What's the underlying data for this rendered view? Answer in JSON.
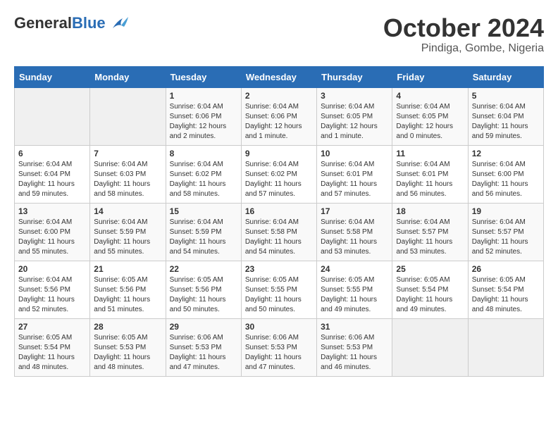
{
  "header": {
    "logo_general": "General",
    "logo_blue": "Blue",
    "month_title": "October 2024",
    "location": "Pindiga, Gombe, Nigeria"
  },
  "days_of_week": [
    "Sunday",
    "Monday",
    "Tuesday",
    "Wednesday",
    "Thursday",
    "Friday",
    "Saturday"
  ],
  "weeks": [
    [
      {
        "day": "",
        "empty": true
      },
      {
        "day": "",
        "empty": true
      },
      {
        "day": "1",
        "sunrise": "Sunrise: 6:04 AM",
        "sunset": "Sunset: 6:06 PM",
        "daylight": "Daylight: 12 hours and 2 minutes."
      },
      {
        "day": "2",
        "sunrise": "Sunrise: 6:04 AM",
        "sunset": "Sunset: 6:06 PM",
        "daylight": "Daylight: 12 hours and 1 minute."
      },
      {
        "day": "3",
        "sunrise": "Sunrise: 6:04 AM",
        "sunset": "Sunset: 6:05 PM",
        "daylight": "Daylight: 12 hours and 1 minute."
      },
      {
        "day": "4",
        "sunrise": "Sunrise: 6:04 AM",
        "sunset": "Sunset: 6:05 PM",
        "daylight": "Daylight: 12 hours and 0 minutes."
      },
      {
        "day": "5",
        "sunrise": "Sunrise: 6:04 AM",
        "sunset": "Sunset: 6:04 PM",
        "daylight": "Daylight: 11 hours and 59 minutes."
      }
    ],
    [
      {
        "day": "6",
        "sunrise": "Sunrise: 6:04 AM",
        "sunset": "Sunset: 6:04 PM",
        "daylight": "Daylight: 11 hours and 59 minutes."
      },
      {
        "day": "7",
        "sunrise": "Sunrise: 6:04 AM",
        "sunset": "Sunset: 6:03 PM",
        "daylight": "Daylight: 11 hours and 58 minutes."
      },
      {
        "day": "8",
        "sunrise": "Sunrise: 6:04 AM",
        "sunset": "Sunset: 6:02 PM",
        "daylight": "Daylight: 11 hours and 58 minutes."
      },
      {
        "day": "9",
        "sunrise": "Sunrise: 6:04 AM",
        "sunset": "Sunset: 6:02 PM",
        "daylight": "Daylight: 11 hours and 57 minutes."
      },
      {
        "day": "10",
        "sunrise": "Sunrise: 6:04 AM",
        "sunset": "Sunset: 6:01 PM",
        "daylight": "Daylight: 11 hours and 57 minutes."
      },
      {
        "day": "11",
        "sunrise": "Sunrise: 6:04 AM",
        "sunset": "Sunset: 6:01 PM",
        "daylight": "Daylight: 11 hours and 56 minutes."
      },
      {
        "day": "12",
        "sunrise": "Sunrise: 6:04 AM",
        "sunset": "Sunset: 6:00 PM",
        "daylight": "Daylight: 11 hours and 56 minutes."
      }
    ],
    [
      {
        "day": "13",
        "sunrise": "Sunrise: 6:04 AM",
        "sunset": "Sunset: 6:00 PM",
        "daylight": "Daylight: 11 hours and 55 minutes."
      },
      {
        "day": "14",
        "sunrise": "Sunrise: 6:04 AM",
        "sunset": "Sunset: 5:59 PM",
        "daylight": "Daylight: 11 hours and 55 minutes."
      },
      {
        "day": "15",
        "sunrise": "Sunrise: 6:04 AM",
        "sunset": "Sunset: 5:59 PM",
        "daylight": "Daylight: 11 hours and 54 minutes."
      },
      {
        "day": "16",
        "sunrise": "Sunrise: 6:04 AM",
        "sunset": "Sunset: 5:58 PM",
        "daylight": "Daylight: 11 hours and 54 minutes."
      },
      {
        "day": "17",
        "sunrise": "Sunrise: 6:04 AM",
        "sunset": "Sunset: 5:58 PM",
        "daylight": "Daylight: 11 hours and 53 minutes."
      },
      {
        "day": "18",
        "sunrise": "Sunrise: 6:04 AM",
        "sunset": "Sunset: 5:57 PM",
        "daylight": "Daylight: 11 hours and 53 minutes."
      },
      {
        "day": "19",
        "sunrise": "Sunrise: 6:04 AM",
        "sunset": "Sunset: 5:57 PM",
        "daylight": "Daylight: 11 hours and 52 minutes."
      }
    ],
    [
      {
        "day": "20",
        "sunrise": "Sunrise: 6:04 AM",
        "sunset": "Sunset: 5:56 PM",
        "daylight": "Daylight: 11 hours and 52 minutes."
      },
      {
        "day": "21",
        "sunrise": "Sunrise: 6:05 AM",
        "sunset": "Sunset: 5:56 PM",
        "daylight": "Daylight: 11 hours and 51 minutes."
      },
      {
        "day": "22",
        "sunrise": "Sunrise: 6:05 AM",
        "sunset": "Sunset: 5:56 PM",
        "daylight": "Daylight: 11 hours and 50 minutes."
      },
      {
        "day": "23",
        "sunrise": "Sunrise: 6:05 AM",
        "sunset": "Sunset: 5:55 PM",
        "daylight": "Daylight: 11 hours and 50 minutes."
      },
      {
        "day": "24",
        "sunrise": "Sunrise: 6:05 AM",
        "sunset": "Sunset: 5:55 PM",
        "daylight": "Daylight: 11 hours and 49 minutes."
      },
      {
        "day": "25",
        "sunrise": "Sunrise: 6:05 AM",
        "sunset": "Sunset: 5:54 PM",
        "daylight": "Daylight: 11 hours and 49 minutes."
      },
      {
        "day": "26",
        "sunrise": "Sunrise: 6:05 AM",
        "sunset": "Sunset: 5:54 PM",
        "daylight": "Daylight: 11 hours and 48 minutes."
      }
    ],
    [
      {
        "day": "27",
        "sunrise": "Sunrise: 6:05 AM",
        "sunset": "Sunset: 5:54 PM",
        "daylight": "Daylight: 11 hours and 48 minutes."
      },
      {
        "day": "28",
        "sunrise": "Sunrise: 6:05 AM",
        "sunset": "Sunset: 5:53 PM",
        "daylight": "Daylight: 11 hours and 48 minutes."
      },
      {
        "day": "29",
        "sunrise": "Sunrise: 6:06 AM",
        "sunset": "Sunset: 5:53 PM",
        "daylight": "Daylight: 11 hours and 47 minutes."
      },
      {
        "day": "30",
        "sunrise": "Sunrise: 6:06 AM",
        "sunset": "Sunset: 5:53 PM",
        "daylight": "Daylight: 11 hours and 47 minutes."
      },
      {
        "day": "31",
        "sunrise": "Sunrise: 6:06 AM",
        "sunset": "Sunset: 5:53 PM",
        "daylight": "Daylight: 11 hours and 46 minutes."
      },
      {
        "day": "",
        "empty": true
      },
      {
        "day": "",
        "empty": true
      }
    ]
  ]
}
